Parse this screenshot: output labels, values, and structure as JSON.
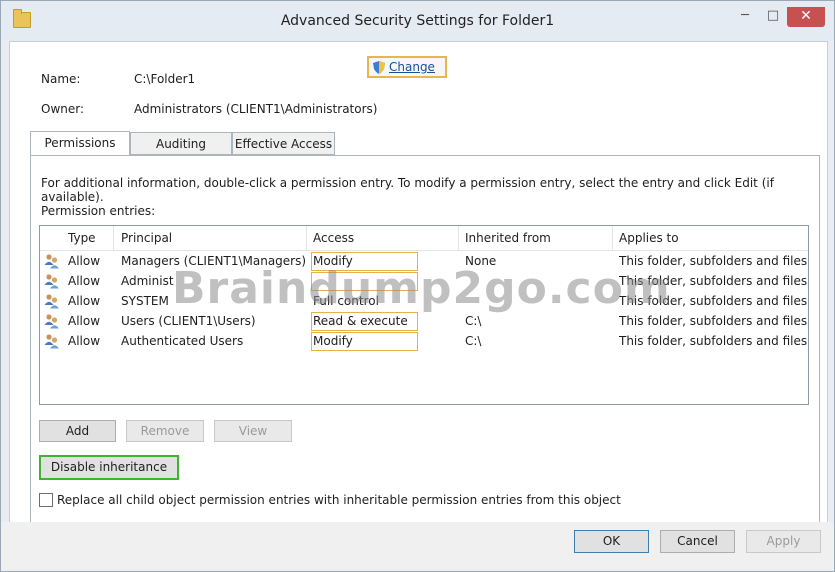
{
  "window": {
    "title": "Advanced Security Settings for Folder1",
    "min_glyph": "─",
    "max_glyph": "□",
    "close_glyph": "✕"
  },
  "info": {
    "name_label": "Name:",
    "name_value": "C:\\Folder1",
    "owner_label": "Owner:",
    "owner_value": "Administrators (CLIENT1\\Administrators)",
    "change_label": "Change"
  },
  "tabs": [
    {
      "label": "Permissions",
      "active": true
    },
    {
      "label": "Auditing",
      "active": false
    },
    {
      "label": "Effective Access",
      "active": false
    }
  ],
  "panel": {
    "info_text": "For additional information, double-click a permission entry. To modify a permission entry, select the entry and click Edit (if available).",
    "entries_label": "Permission entries:"
  },
  "table": {
    "headers": [
      "Type",
      "Principal",
      "Access",
      "Inherited from",
      "Applies to"
    ],
    "rows": [
      {
        "type": "Allow",
        "principal": "Managers (CLIENT1\\Managers)",
        "access": "Modify",
        "inherited": "None",
        "applies": "This folder, subfolders and files"
      },
      {
        "type": "Allow",
        "principal": "Administ",
        "access": "",
        "inherited": "",
        "applies": "This folder, subfolders and files"
      },
      {
        "type": "Allow",
        "principal": "SYSTEM",
        "access": "Full control",
        "inherited": "",
        "applies": "This folder, subfolders and files"
      },
      {
        "type": "Allow",
        "principal": "Users (CLIENT1\\Users)",
        "access": "Read & execute",
        "inherited": "C:\\",
        "applies": "This folder, subfolders and files"
      },
      {
        "type": "Allow",
        "principal": "Authenticated Users",
        "access": "Modify",
        "inherited": "C:\\",
        "applies": "This folder, subfolders and files"
      }
    ]
  },
  "buttons": {
    "add": "Add",
    "remove": "Remove",
    "view": "View",
    "disable_inheritance": "Disable inheritance",
    "ok": "OK",
    "cancel": "Cancel",
    "apply": "Apply"
  },
  "replace_checkbox": {
    "label": "Replace all child object permission entries with inheritable permission entries from this object",
    "checked": false
  },
  "watermark": "Braindump2go.com",
  "colors": {
    "highlight_orange": "#e6b04a",
    "highlight_green": "#3fb52f",
    "close_red": "#c75050",
    "link_blue": "#1a4f9c"
  }
}
